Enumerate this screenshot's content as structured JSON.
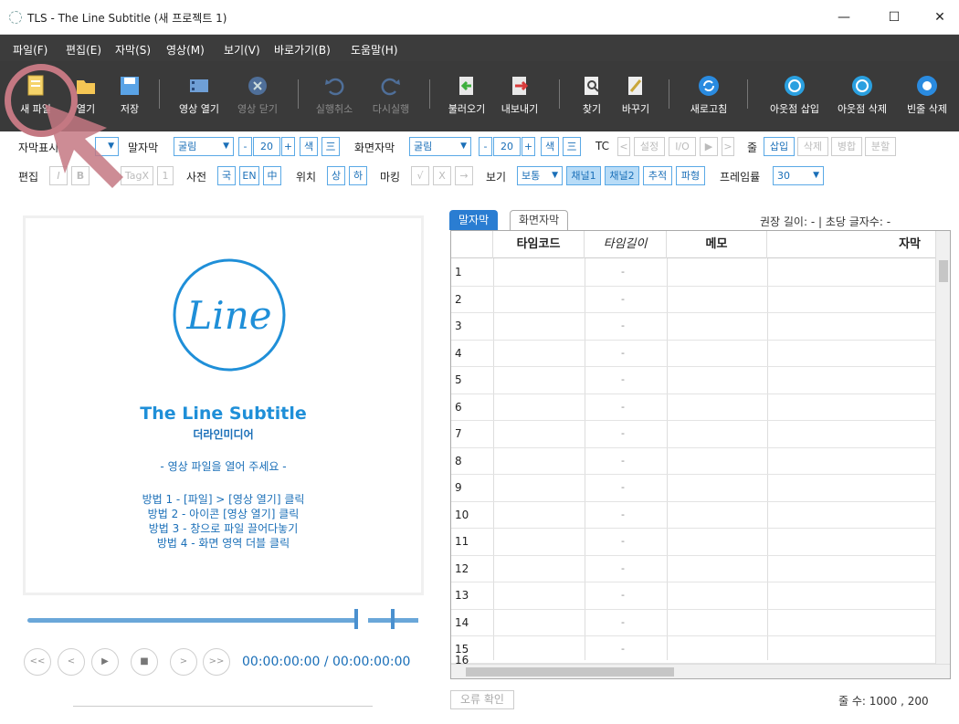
{
  "window": {
    "title": "TLS - The Line Subtitle (새 프로젝트 1)",
    "min": "—",
    "max": "☐",
    "close": "✕"
  },
  "menu": [
    "파일(F)",
    "편집(E)",
    "자막(S)",
    "영상(M)",
    "보기(V)",
    "바로가기(B)",
    "도움말(H)"
  ],
  "toolbar": {
    "new": "새 파일",
    "open": "열기",
    "save": "저장",
    "video_open": "영상 열기",
    "video_close": "영상 닫기",
    "undo": "실행취소",
    "redo": "다시실행",
    "import": "불러오기",
    "export": "내보내기",
    "find": "찾기",
    "replace": "바꾸기",
    "refresh": "새로고침",
    "outpoint_insert": "아웃점 삽입",
    "outpoint_delete": "아웃점 삭제",
    "blank_delete": "빈줄 삭제"
  },
  "row1": {
    "subtitle_display_label": "자막표시",
    "speech_label": "말자막",
    "speech_font": "굴림",
    "speech_size": "20",
    "minus": "-",
    "plus": "+",
    "color": "색",
    "align": "三",
    "screen_label": "화면자막",
    "screen_font": "굴림",
    "screen_size": "20",
    "tc_label": "TC",
    "tc_prev": "<",
    "tc_set": "설정",
    "tc_io": "I/O",
    "tc_play": "▶",
    "tc_next": ">",
    "line_label": "줄",
    "insert": "삽입",
    "delete": "삭제",
    "merge": "병합",
    "split": "분할"
  },
  "row2": {
    "edit_label": "편집",
    "italic": "I",
    "bold": "B",
    "tagx": "TagX",
    "one": "1",
    "dict_label": "사전",
    "dict_ko": "국",
    "dict_en": "EN",
    "dict_zh": "中",
    "pos_label": "위치",
    "pos_top": "상",
    "pos_bottom": "하",
    "mark_label": "마킹",
    "mark_check": "√",
    "mark_x": "X",
    "mark_arrow": "→",
    "view_label": "보기",
    "view_mode": "보통",
    "ch1": "채널1",
    "ch2": "채널2",
    "track": "추적",
    "wave": "파형",
    "fps_label": "프레임률",
    "fps": "30"
  },
  "video": {
    "logo_text": "Line",
    "title": "The Line Subtitle",
    "company": "더라인미디어",
    "hint": "- 영상 파일을 열어 주세요 -",
    "methods": [
      "방법 1 - [파일] > [영상 열기] 클릭",
      "방법 2 - 아이콘 [영상 열기] 클릭",
      "방법 3 - 창으로 파일 끌어다놓기",
      "방법 4 - 화면 영역 더블 클릭"
    ],
    "timecode": "00:00:00:00 / 00:00:00:00",
    "buttons": [
      "<<",
      "<",
      "▶",
      "■",
      ">",
      ">>"
    ]
  },
  "grid": {
    "tabs": [
      "말자막",
      "화면자막"
    ],
    "rate": "권장 길이: -   |   초당 글자수: -",
    "headers": [
      "타임코드",
      "타임길이",
      "메모",
      "자막"
    ],
    "rows": [
      "1",
      "2",
      "3",
      "4",
      "5",
      "6",
      "7",
      "8",
      "9",
      "10",
      "11",
      "12",
      "13",
      "14",
      "15",
      "16"
    ],
    "dash": "-"
  },
  "footer": {
    "error_check": "오류 확인",
    "row_count": "줄 수:  1000 ,  200"
  },
  "colors": {
    "accent": "#2a7dd2",
    "toolbar_bg": "#3a3a3a",
    "menubar_bg": "#3c3c3c",
    "cursor": "#c47882"
  }
}
